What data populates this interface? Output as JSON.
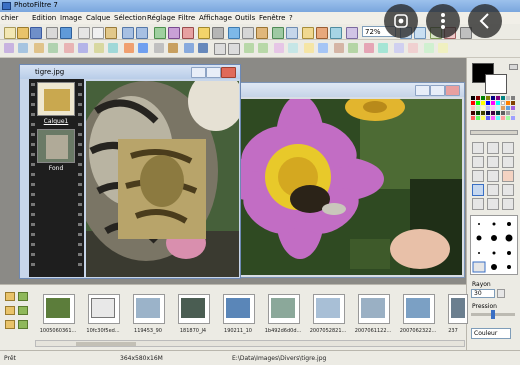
{
  "window": {
    "title": "PhotoFiltre 7"
  },
  "menu": [
    "chier",
    "Edition",
    "Image",
    "Calque",
    "Sélection",
    "Réglage",
    "Filtre",
    "Affichage",
    "Outils",
    "Fenêtre",
    "?"
  ],
  "toolbar": {
    "zoom_value": "72%"
  },
  "doc1": {
    "title": "tigre.jpg",
    "layers": [
      {
        "label": "Calque1"
      },
      {
        "label": "Fond"
      }
    ]
  },
  "right_panel": {
    "rayon_label": "Rayon",
    "rayon_value": "30",
    "pression_label": "Pression",
    "couleur_label": "Couleur"
  },
  "thumbnails": [
    {
      "label": "1005060361..."
    },
    {
      "label": "10fc30f5ed..."
    },
    {
      "label": "119453_90"
    },
    {
      "label": "181870_J4"
    },
    {
      "label": "190211_10"
    },
    {
      "label": "1b492d6d0d..."
    },
    {
      "label": "2007052821..."
    },
    {
      "label": "2007061122..."
    },
    {
      "label": "2007062322..."
    },
    {
      "label": "237"
    }
  ],
  "status": {
    "ready": "Prêt",
    "dimensions": "364x580x16M",
    "path": "E:\\Data\\Images\\Divers\\tigre.jpg"
  },
  "colors": {
    "titlebar": "#9cc1ec",
    "workspace": "#8b8a86",
    "selection": "#0a3bd6"
  }
}
